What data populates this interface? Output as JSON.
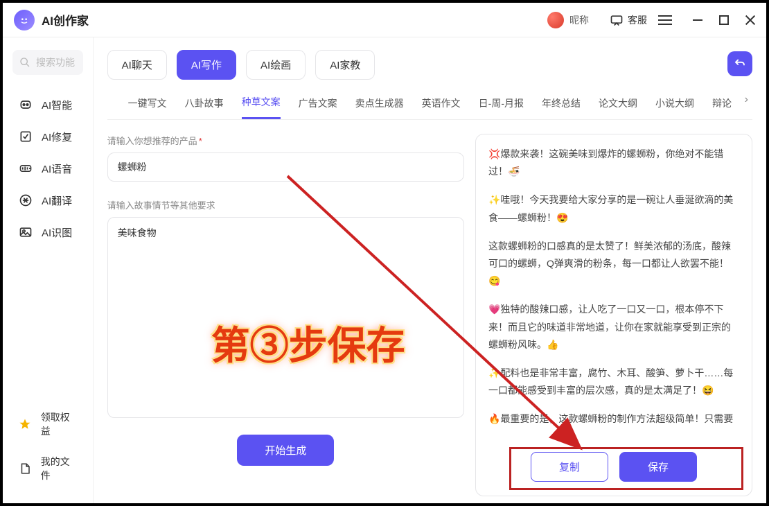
{
  "app": {
    "title": "AI创作家"
  },
  "titlebar": {
    "nickname": "昵称",
    "support": "客服"
  },
  "sidebar": {
    "search_placeholder": "搜索功能",
    "items": [
      {
        "label": "AI智能"
      },
      {
        "label": "AI修复"
      },
      {
        "label": "AI语音"
      },
      {
        "label": "AI翻译"
      },
      {
        "label": "AI识图"
      }
    ],
    "bottom": [
      {
        "label": "领取权益"
      },
      {
        "label": "我的文件"
      }
    ]
  },
  "modes": {
    "items": [
      "AI聊天",
      "AI写作",
      "AI绘画",
      "AI家教"
    ],
    "active_index": 1
  },
  "subtabs": {
    "items": [
      "一键写文",
      "八卦故事",
      "种草文案",
      "广告文案",
      "卖点生成器",
      "英语作文",
      "日-周-月报",
      "年终总结",
      "论文大纲",
      "小说大纲",
      "辩论"
    ],
    "active_index": 2
  },
  "form": {
    "product_label": "请输入你想推荐的产品",
    "product_value": "螺蛳粉",
    "detail_label": "请输入故事情节等其他要求",
    "detail_value": "美味食物",
    "generate_label": "开始生成"
  },
  "output": {
    "paragraphs": [
      "💢爆款来袭！这碗美味到爆炸的螺蛳粉，你绝对不能错过！🍜",
      "✨哇哦！今天我要给大家分享的是一碗让人垂涎欲滴的美食——螺蛳粉！😍",
      "这款螺蛳粉的口感真的是太赞了！鲜美浓郁的汤底，酸辣可口的螺蛳，Q弹爽滑的粉条，每一口都让人欲罢不能！😋",
      "💗独特的酸辣口感，让人吃了一口又一口，根本停不下来！而且它的味道非常地道，让你在家就能享受到正宗的螺蛳粉风味。👍",
      "✨配料也是非常丰富，腐竹、木耳、酸笋、萝卜干……每一口都能感受到丰富的层次感，真的是太满足了！😆",
      "🔥最重要的是，这款螺蛳粉的制作方法超级简单！只需要"
    ],
    "copy_label": "复制",
    "save_label": "保存"
  },
  "annotation": {
    "text": "第③步保存"
  }
}
